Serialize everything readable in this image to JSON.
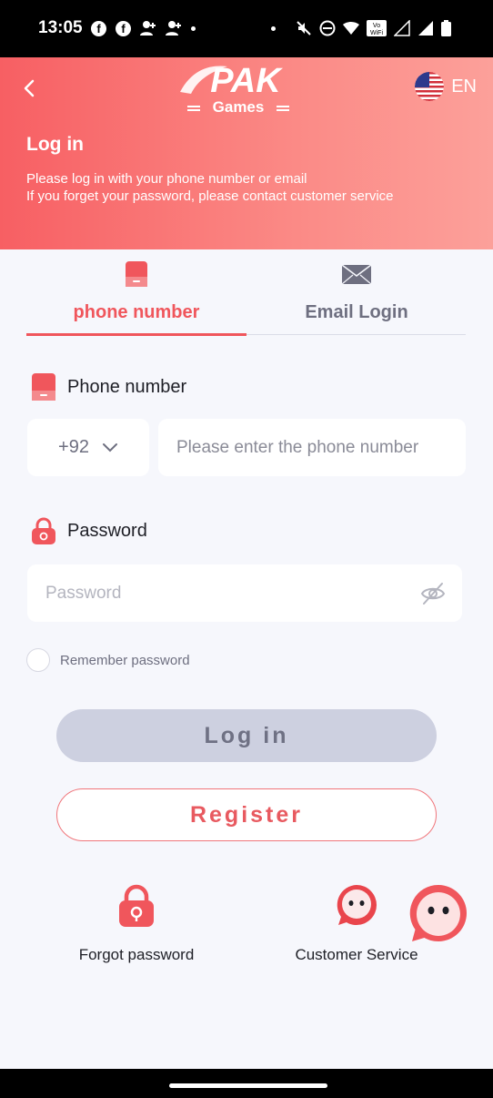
{
  "status_bar": {
    "time": "13:05",
    "left_icons": [
      "facebook-icon",
      "facebook-icon",
      "person-add-icon",
      "person-add-icon",
      "dot"
    ],
    "right_icons": [
      "mute-icon",
      "dnd-icon",
      "wifi-icon",
      "vowifi-icon",
      "signal-icon",
      "signal-icon",
      "battery-icon"
    ],
    "vowifi_text": "Vo WiFi"
  },
  "header": {
    "logo_top": "PAK",
    "logo_bottom": "Games",
    "language": "EN",
    "title": "Log in",
    "subtitle_line1": "Please log in with your phone number or email",
    "subtitle_line2": "If you forget your password, please contact customer service",
    "gradient_start": "#f75f63",
    "gradient_end": "#fca09a"
  },
  "tabs": [
    {
      "label": "phone number",
      "icon": "phone-icon",
      "active": true
    },
    {
      "label": "Email Login",
      "icon": "mail-icon",
      "active": false
    }
  ],
  "form": {
    "phone_label": "Phone number",
    "country_code": "+92",
    "phone_placeholder": "Please enter the phone number",
    "password_label": "Password",
    "password_placeholder": "Password",
    "remember_label": "Remember password"
  },
  "buttons": {
    "login": "Log in",
    "register": "Register"
  },
  "actions": {
    "forgot_password": "Forgot password",
    "customer_service": "Customer Service"
  },
  "colors": {
    "accent": "#f0565c",
    "login_disabled_bg": "#cdd0e0",
    "page_bg": "#f6f7fc"
  }
}
